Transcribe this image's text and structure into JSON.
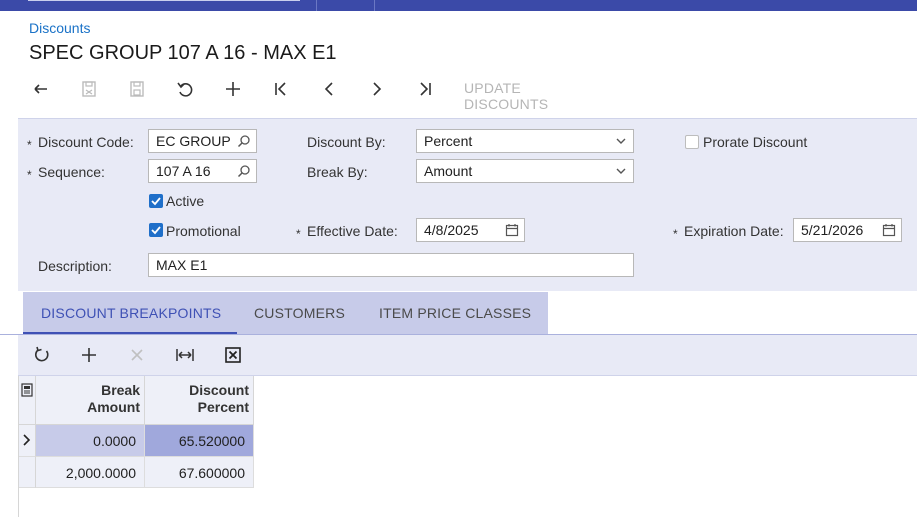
{
  "breadcrumb": "Discounts",
  "page_title": "SPEC GROUP 107 A 16 - MAX E1",
  "toolbar": {
    "update_discounts_label": "UPDATE DISCOUNTS"
  },
  "form": {
    "discount_code_label": "Discount Code:",
    "discount_code_value": "EC GROUP",
    "sequence_label": "Sequence:",
    "sequence_value": "107 A 16",
    "active_label": "Active",
    "active_checked": true,
    "promotional_label": "Promotional",
    "promotional_checked": true,
    "discount_by_label": "Discount By:",
    "discount_by_value": "Percent",
    "break_by_label": "Break By:",
    "break_by_value": "Amount",
    "effective_date_label": "Effective Date:",
    "effective_date_value": "4/8/2025",
    "prorate_label": "Prorate Discount",
    "prorate_checked": false,
    "expiration_date_label": "Expiration Date:",
    "expiration_date_value": "5/21/2026",
    "description_label": "Description:",
    "description_value": "MAX E1",
    "required_mark": "*"
  },
  "tabs": [
    {
      "label": "DISCOUNT BREAKPOINTS",
      "active": true
    },
    {
      "label": "CUSTOMERS",
      "active": false
    },
    {
      "label": "ITEM PRICE CLASSES",
      "active": false
    }
  ],
  "grid": {
    "columns": [
      {
        "line1": "Break",
        "line2": "Amount"
      },
      {
        "line1": "Discount",
        "line2": "Percent"
      }
    ],
    "rows": [
      {
        "break_amount": "0.0000",
        "discount_percent": "65.520000",
        "selected": true
      },
      {
        "break_amount": "2,000.0000",
        "discount_percent": "67.600000",
        "selected": false
      }
    ]
  },
  "colors": {
    "accent": "#3f51b5",
    "link": "#1a72c7",
    "form_bg": "#e8eaf6",
    "selected_row": "#c7cbe9",
    "selected_cell": "#a0a8dc"
  }
}
